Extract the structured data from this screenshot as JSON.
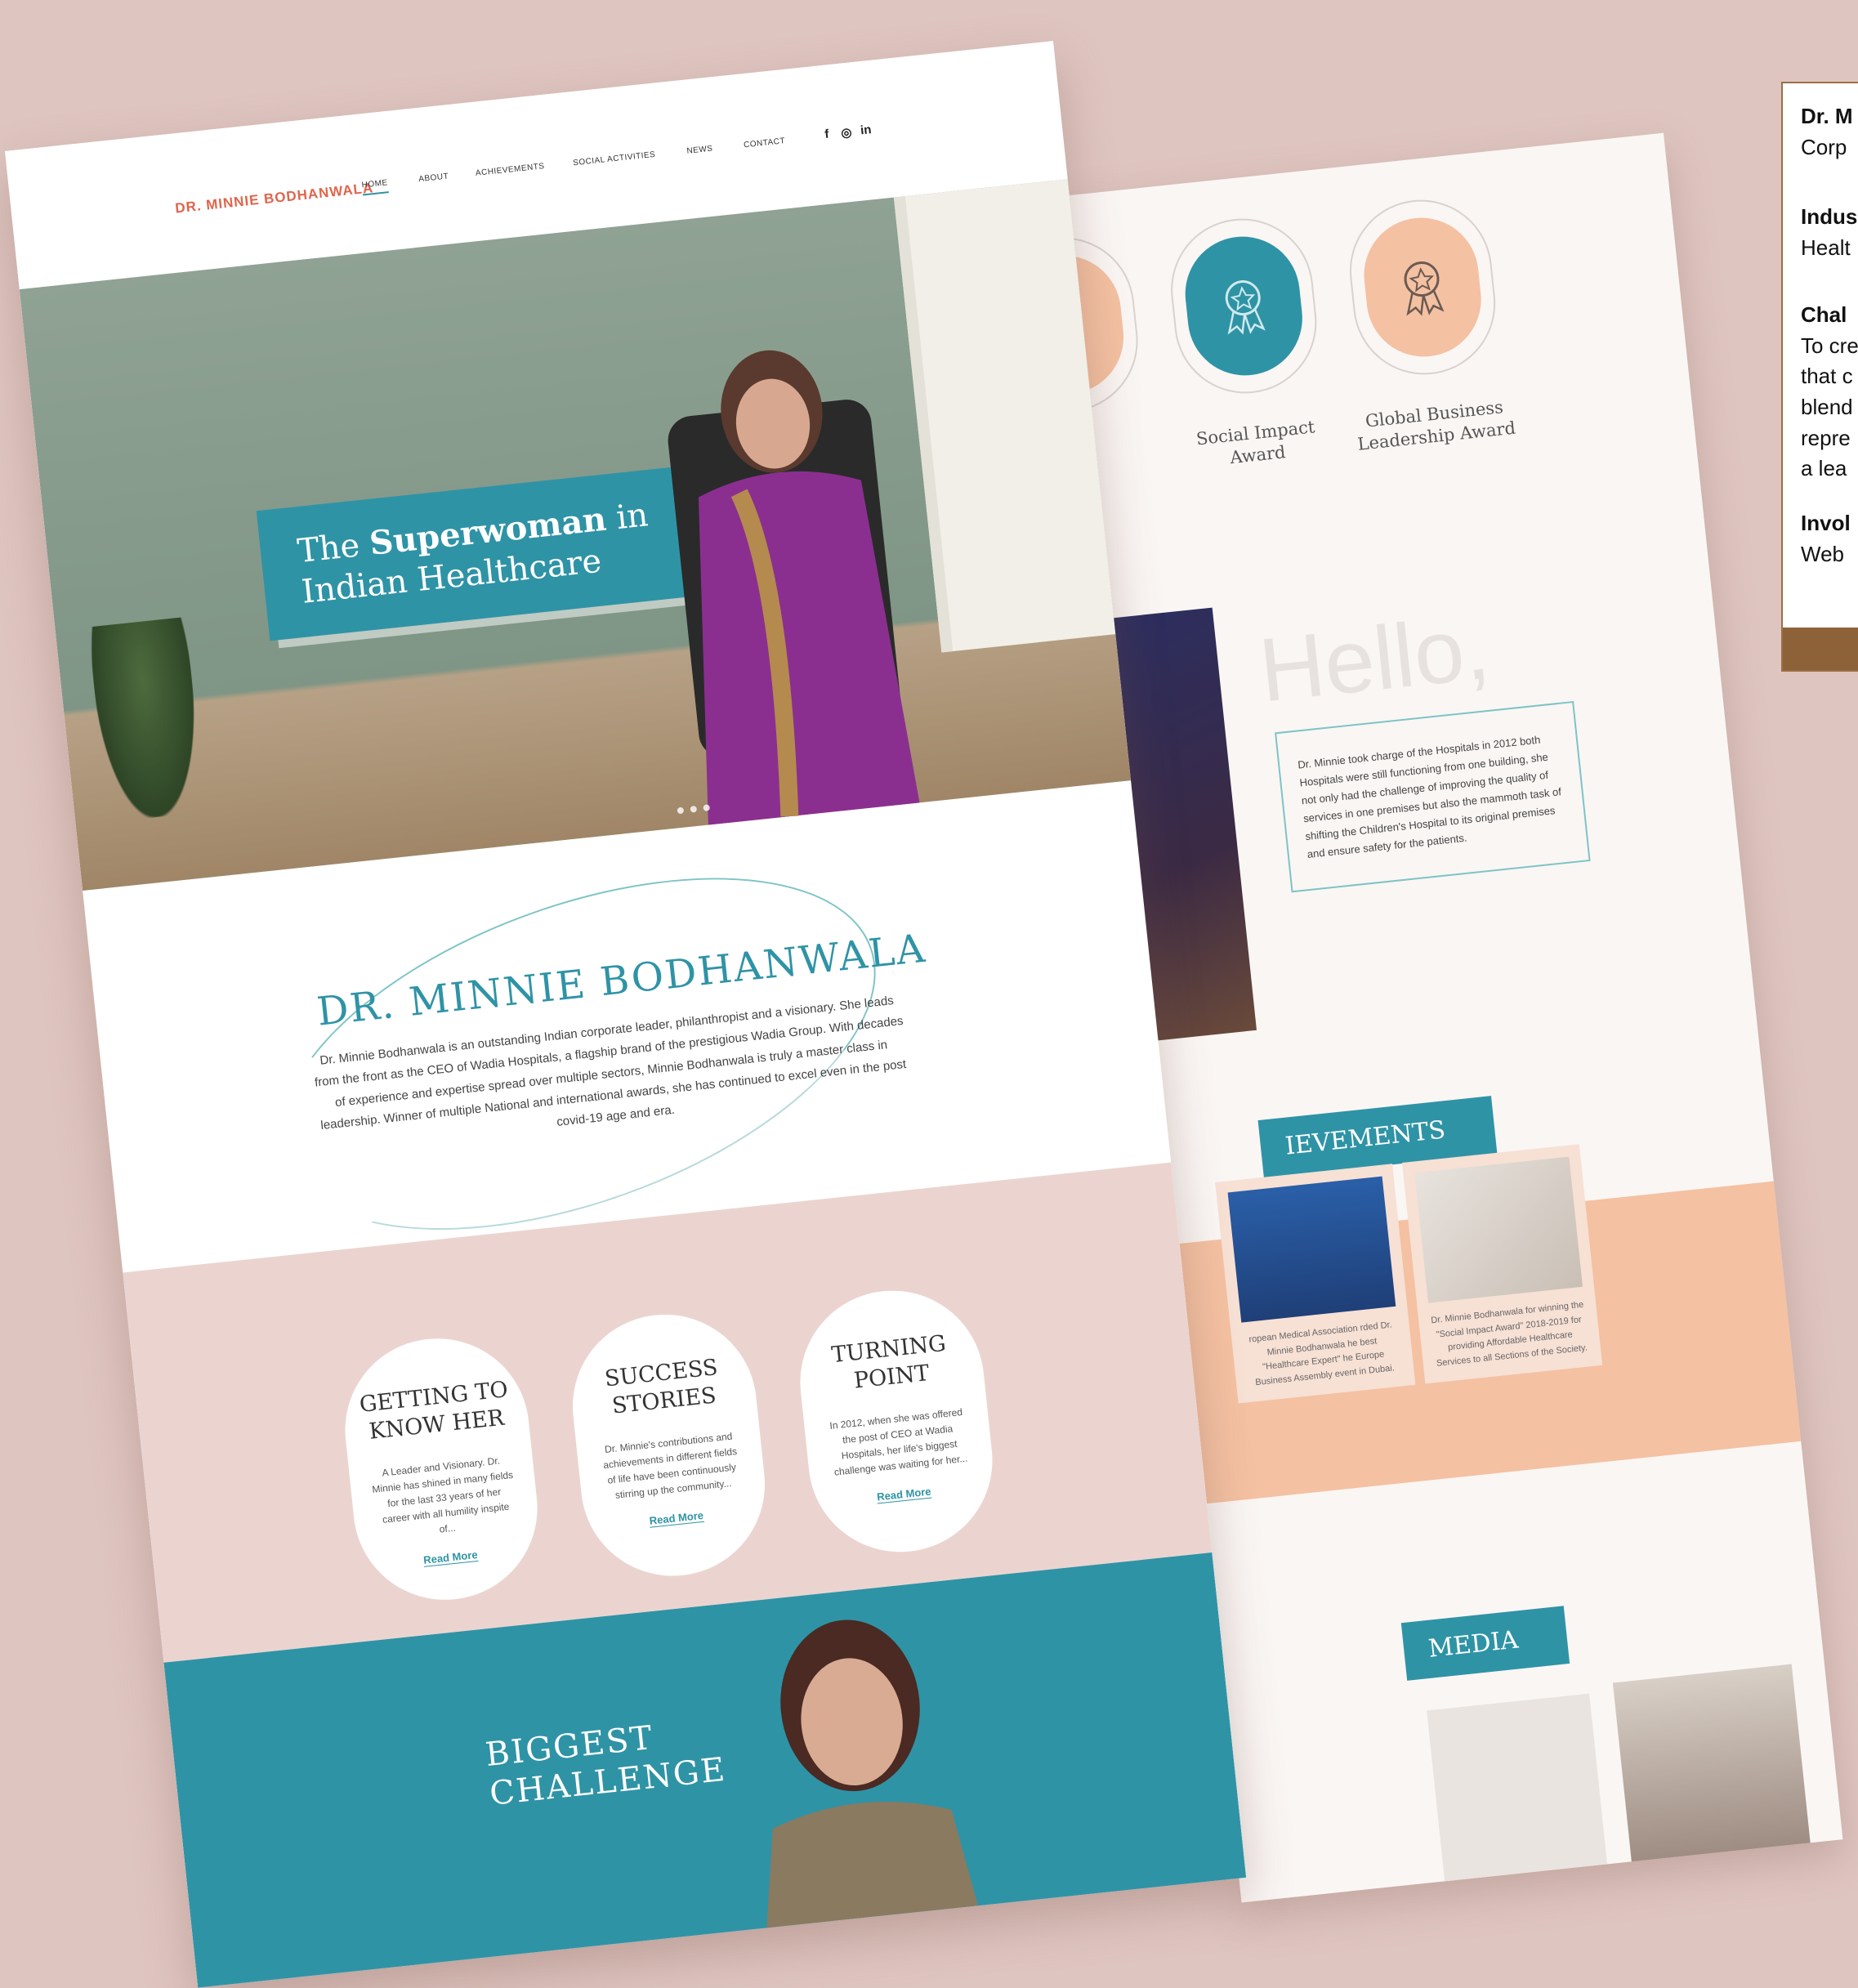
{
  "nav": {
    "logo": "DR. MINNIE BODHANWALA",
    "items": [
      "HOME",
      "ABOUT",
      "ACHIEVEMENTS",
      "SOCIAL ACTIVITIES",
      "NEWS",
      "CONTACT"
    ],
    "social": [
      "f",
      "◎",
      "in"
    ]
  },
  "hero": {
    "line1_pre": "The ",
    "line1_bold": "Superwoman",
    "line1_post": " in",
    "line2": "Indian Healthcare"
  },
  "intro": {
    "title": "DR. MINNIE BODHANWALA",
    "text": "Dr. Minnie Bodhanwala is an outstanding Indian corporate leader, philanthropist and a visionary. She leads from the front as the CEO of Wadia Hospitals, a flagship brand of the prestigious Wadia Group. With decades of experience and expertise spread over multiple sectors, Minnie Bodhanwala is truly a master class in leadership. Winner of multiple National and international awards, she has continued to excel even in the post covid-19 age and era."
  },
  "cards": [
    {
      "title": "GETTING TO KNOW HER",
      "text": "A Leader and Visionary. Dr. Minnie has shined in many fields for the last 33 years of her career with all humility inspite of...",
      "link": "Read More"
    },
    {
      "title": "SUCCESS STORIES",
      "text": "Dr. Minnie's contributions and achievements in different fields of life have been continuously stirring up the community...",
      "link": "Read More"
    },
    {
      "title": "TURNING POINT",
      "text": "In 2012, when she was offered the post of CEO at Wadia Hospitals, her life's biggest challenge was waiting for her...",
      "link": "Read More"
    }
  ],
  "biggest": {
    "line1": "BIGGEST",
    "line2": "CHALLENGE"
  },
  "awards": [
    {
      "label": "Social Impact Award"
    },
    {
      "label": "Global Business Leadership Award"
    }
  ],
  "award_colors": {
    "teal": "#2f93a6",
    "peach": "#f4c1a2"
  },
  "hello": {
    "heading": "Hello,",
    "text": "Dr. Minnie took charge of the Hospitals in 2012 both Hospitals were still functioning from one building, she not only had the challenge of improving the quality of services in one premises but also the mammoth task of shifting the Children's Hospital to its original premises and ensure safety for the patients."
  },
  "achievements": {
    "heading": "IEVEMENTS",
    "cards": [
      {
        "text": "ropean Medical Association rded Dr. Minnie Bodhanwala he best \"Healthcare Expert\" he Europe Business Assembly event in Dubai."
      },
      {
        "text": "Dr. Minnie Bodhanwala for winning the \"Social Impact Award\" 2018-2019 for providing Affordable Healthcare Services to all Sections of the Society."
      }
    ]
  },
  "media": {
    "heading": "MEDIA"
  },
  "info": {
    "name": "Dr. M",
    "name_rest": "Corp",
    "industry_label": "Indus",
    "industry": "Healt",
    "challenge_label": "Chal",
    "challenge_lines": [
      "To cre",
      "that c",
      "blend",
      "repre",
      "a lea"
    ],
    "involvement_label": "Invol",
    "involvement": "Web"
  }
}
